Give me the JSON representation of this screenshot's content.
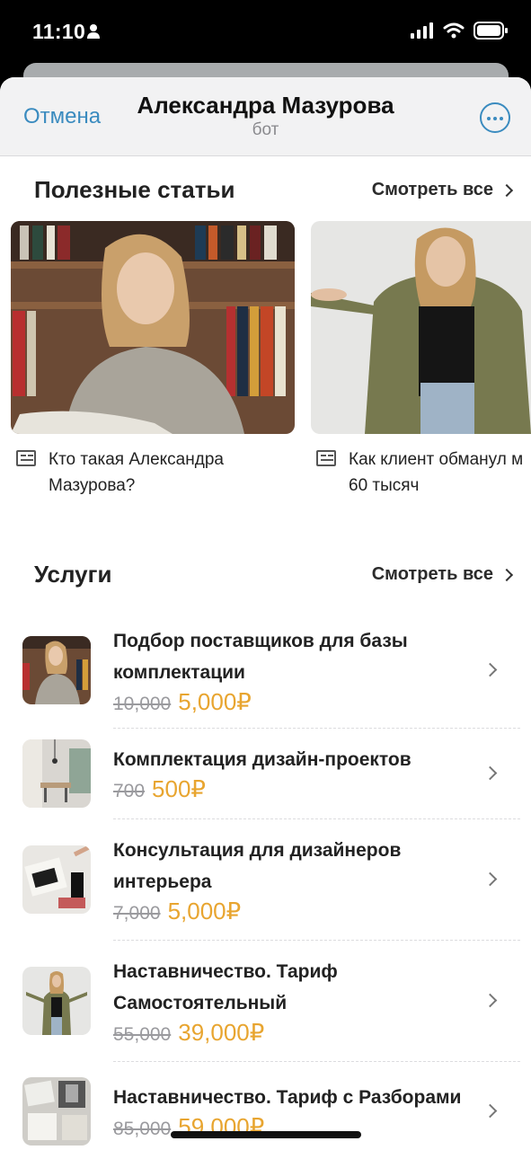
{
  "status": {
    "time": "11:10"
  },
  "nav": {
    "cancel": "Отмена",
    "title": "Александра Мазурова",
    "subtitle": "бот"
  },
  "articles_section": {
    "title": "Полезные статьи",
    "see_all": "Смотреть все",
    "items": [
      {
        "title_line1": "Кто такая Александра",
        "title_line2": "Мазурова?"
      },
      {
        "title_line1": "Как клиент обманул м",
        "title_line2": "60 тысяч"
      }
    ]
  },
  "services_section": {
    "title": "Услуги",
    "see_all": "Смотреть все",
    "items": [
      {
        "name": "Подбор поставщиков для базы комплектации",
        "old_price": "10,000",
        "new_price": "5,000₽"
      },
      {
        "name": "Комплектация дизайн-проектов",
        "old_price": "700",
        "new_price": "500₽"
      },
      {
        "name": "Консультация для дизайнеров интерьера",
        "old_price": "7,000",
        "new_price": "5,000₽"
      },
      {
        "name": "Наставничество. Тариф Самостоятельный",
        "old_price": "55,000",
        "new_price": "39,000₽"
      },
      {
        "name": "Наставничество. Тариф с Разборами",
        "old_price": "85,000",
        "new_price": "59,000₽"
      }
    ]
  },
  "colors": {
    "accent": "#3a8bbf",
    "price": "#e8a530"
  }
}
